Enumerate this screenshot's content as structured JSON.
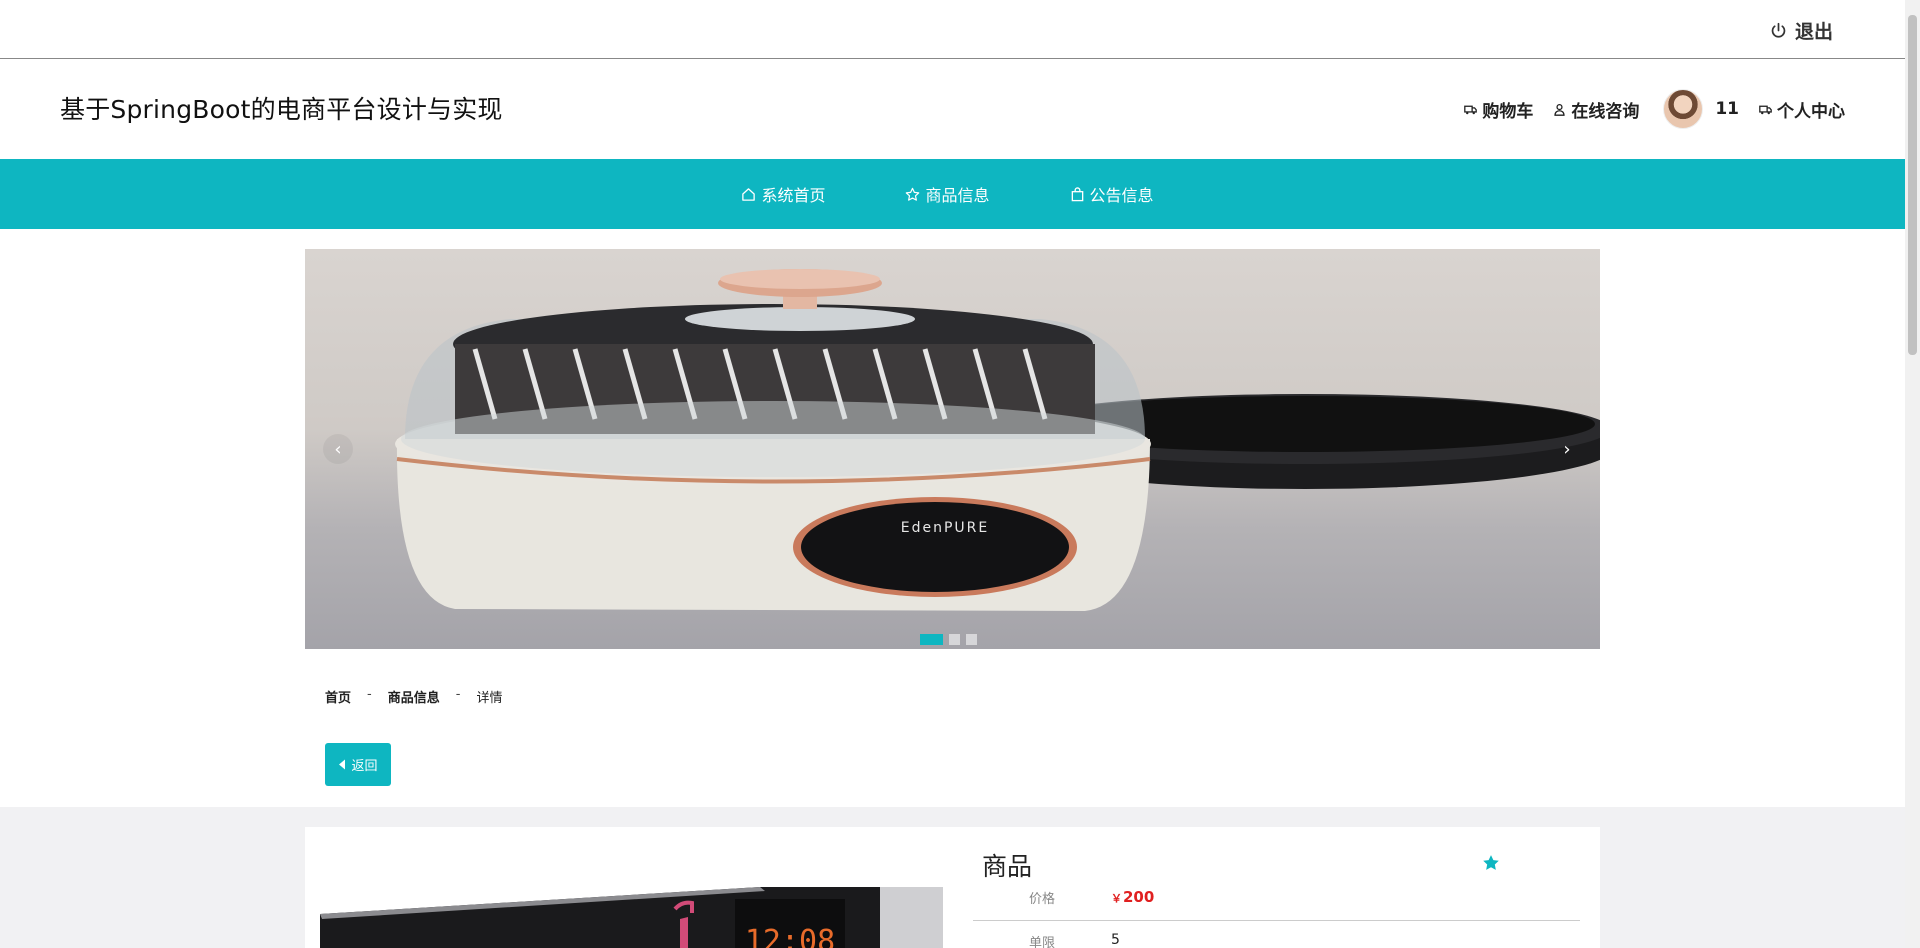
{
  "topbar": {
    "logout_label": "退出"
  },
  "header": {
    "site_title": "基于SpringBoot的电商平台设计与实现",
    "cart_label": "购物车",
    "consult_label": "在线咨询",
    "username": "11",
    "profile_label": "个人中心"
  },
  "mainnav": {
    "items": [
      {
        "label": "系统首页",
        "icon": "home-icon"
      },
      {
        "label": "商品信息",
        "icon": "star-icon"
      },
      {
        "label": "公告信息",
        "icon": "bag-icon"
      }
    ]
  },
  "carousel": {
    "prev": "‹",
    "next": "›",
    "slide_count": 3,
    "active_index": 0,
    "brand_text": "EdenPURE"
  },
  "breadcrumb": {
    "home": "首页",
    "sep": "-",
    "category": "商品信息",
    "current": "详情"
  },
  "back_button": {
    "label": "返回"
  },
  "detail": {
    "title": "商品",
    "price_label": "价格",
    "currency": "￥",
    "price_value": "200",
    "limit_label": "单限",
    "limit_value": "5",
    "display_time": "12:08"
  },
  "colors": {
    "accent": "#0eb6c1",
    "price": "#e02020"
  }
}
